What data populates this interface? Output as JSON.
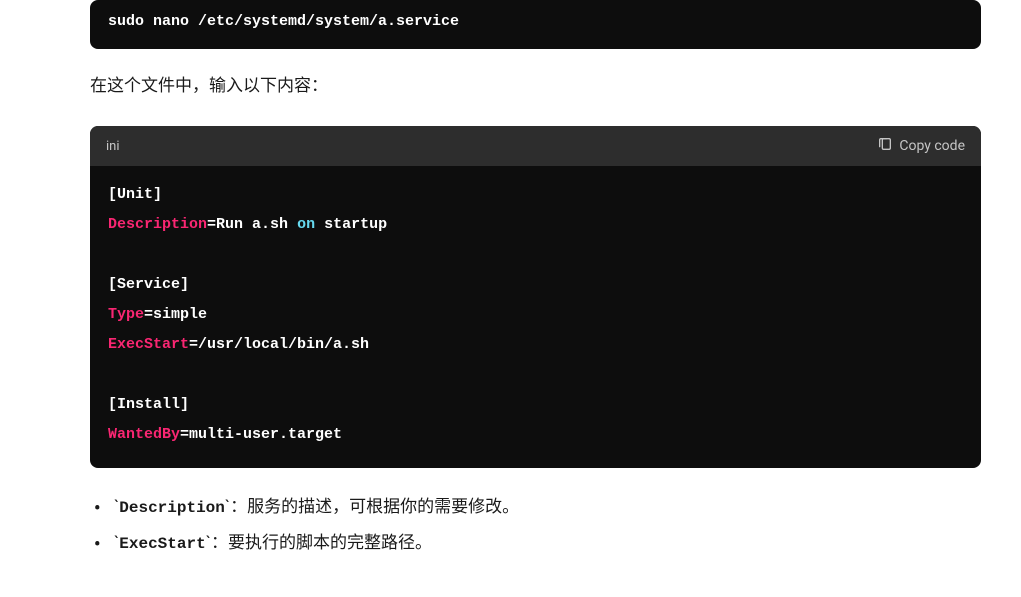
{
  "code_block_top": {
    "content": "sudo nano /etc/systemd/system/a.service"
  },
  "paragraph1": "在这个文件中，输入以下内容：",
  "code_block_main": {
    "lang": "ini",
    "copy_label": "Copy code",
    "unit_section": "[Unit]",
    "desc_key": "Description",
    "desc_val_pre": "Run a.sh ",
    "desc_val_on": "on",
    "desc_val_post": " startup",
    "service_section": "[Service]",
    "type_key": "Type",
    "type_val": "simple",
    "exec_key": "ExecStart",
    "exec_val": "/usr/local/bin/a.sh",
    "install_section": "[Install]",
    "wanted_key": "WantedBy",
    "wanted_val": "multi-user.target"
  },
  "list_items": {
    "item1_code": "Description",
    "item1_text": "：服务的描述，可根据你的需要修改。",
    "item2_code": "ExecStart",
    "item2_text": "：要执行的脚本的完整路径。"
  }
}
